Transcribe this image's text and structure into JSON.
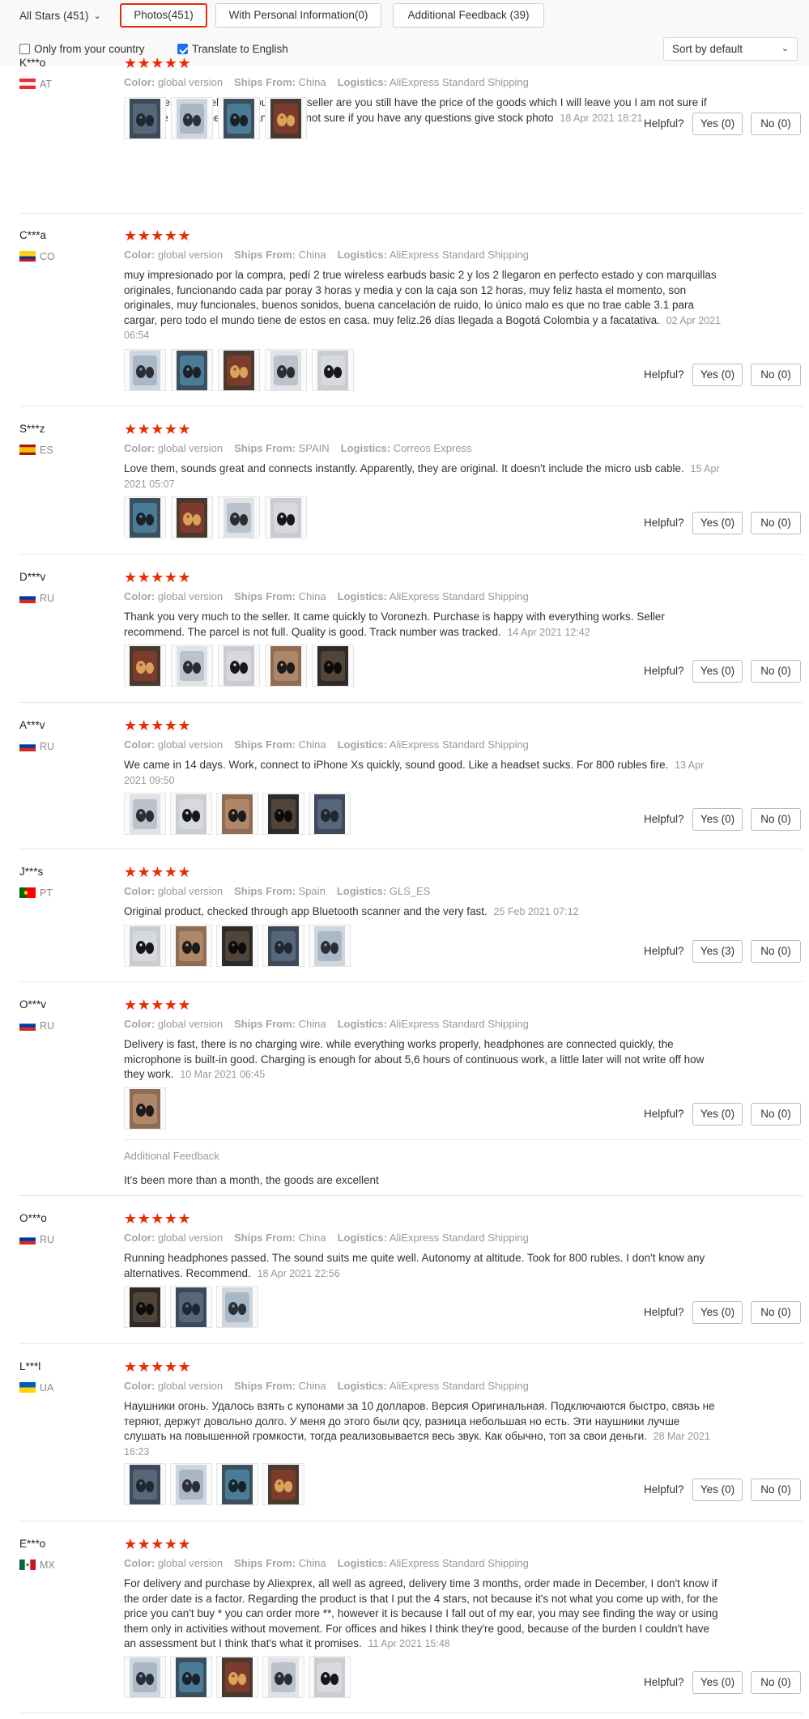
{
  "filters": {
    "all_stars": "All Stars (451)",
    "tabs": [
      {
        "label": "Photos(451)",
        "active": true
      },
      {
        "label": "With Personal Information(0)",
        "active": false
      },
      {
        "label": "Additional Feedback (39)",
        "active": false
      }
    ],
    "only_country": {
      "label": "Only from your country",
      "checked": false
    },
    "translate": {
      "label": "Translate to English",
      "checked": true
    },
    "sort": {
      "selected": "Sort by default"
    }
  },
  "labels": {
    "color": "Color:",
    "ships_from": "Ships From:",
    "logistics": "Logistics:",
    "helpful": "Helpful?",
    "additional_feedback": "Additional Feedback",
    "stars": "★★★★★"
  },
  "colors": {
    "accent": "#e62e04",
    "stars": "#e62e04",
    "meta_text": "#999999"
  },
  "reviews": [
    {
      "user": "K***o",
      "country": "AT",
      "flag": "flag-austria",
      "color": "global version",
      "ships_from": "China",
      "logistics": "AliExpress Standard Shipping",
      "text": "best seller great seller and buyer and seller are you still have the price of the goods which I will leave you I am not sure if you have any further assistance I am not sure if you have any questions give stock photo",
      "date": "18 Apr 2021 18:21",
      "photos": [
        "photo-phone-box",
        "photo-earbuds-blue",
        "photo-phone-screen",
        "photo-product-pack"
      ],
      "yes": "Yes (0)",
      "no": "No (0)"
    },
    {
      "user": "C***a",
      "country": "CO",
      "flag": "flag-colombia",
      "color": "global version",
      "ships_from": "China",
      "logistics": "AliExpress Standard Shipping",
      "text": "muy impresionado por la compra, pedí 2 true wireless earbuds basic 2 y los 2 llegaron en perfecto estado y con marquillas originales, funcionando cada par poray 3 horas y media y con la caja son 12 horas, muy feliz hasta el momento, son originales, muy funcionales, buenos sonidos, buena cancelación de ruido, lo único malo es que no trae cable 3.1 para cargar, pero todo el mundo tiene de estos en casa. muy feliz.26 días llegada a Bogotá Colombia y a facatativa.",
      "date": "02 Apr 2021 06:54",
      "photos": [
        "photo-box-front",
        "photo-earbuds-box",
        "photo-box-side",
        "photo-hand-earbuds",
        "photo-earbuds-case"
      ],
      "yes": "Yes (0)",
      "no": "No (0)"
    },
    {
      "user": "S***z",
      "country": "ES",
      "flag": "flag-spain",
      "color": "global version",
      "ships_from": "SPAIN",
      "logistics": "Correos Express",
      "text": "Love them, sounds great and connects instantly. Apparently, they are original. It doesn't include the micro usb cable.",
      "date": "15 Apr 2021 05:07",
      "photos": [
        "photo-earbud-hand",
        "photo-earbud-hand-2",
        "photo-earbud-hand-3",
        "photo-earbud-hand-4"
      ],
      "yes": "Yes (0)",
      "no": "No (0)"
    },
    {
      "user": "D***v",
      "country": "RU",
      "flag": "flag-russia",
      "color": "global version",
      "ships_from": "China",
      "logistics": "AliExpress Standard Shipping",
      "text": "Thank you very much to the seller. It came quickly to Voronezh. Purchase is happy with everything works. Seller recommend. The parcel is not full. Quality is good. Track number was tracked.",
      "date": "14 Apr 2021 12:42",
      "photos": [
        "photo-earbuds-table",
        "photo-box-blue",
        "photo-earbuds-open",
        "photo-earbuds-pair",
        "photo-case-closed"
      ],
      "yes": "Yes (0)",
      "no": "No (0)"
    },
    {
      "user": "A***v",
      "country": "RU",
      "flag": "flag-russia",
      "color": "global version",
      "ships_from": "China",
      "logistics": "AliExpress Standard Shipping",
      "text": "We came in 14 days. Work, connect to iPhone Xs quickly, sound good. Like a headset sucks. For 800 rubles fire.",
      "date": "13 Apr 2021 09:50",
      "photos": [
        "photo-earbud-palm",
        "photo-earbud-palm-2",
        "photo-case-open",
        "photo-case-dark",
        "photo-earbud-fingers"
      ],
      "yes": "Yes (0)",
      "no": "No (0)"
    },
    {
      "user": "J***s",
      "country": "PT",
      "flag": "flag-portugal",
      "color": "global version",
      "ships_from": "Spain",
      "logistics": "GLS_ES",
      "text": "Original product, checked through app Bluetooth scanner and the very fast.",
      "date": "25 Feb 2021 07:12",
      "photos": [
        "photo-box-white",
        "photo-box-white-2",
        "photo-phone-app",
        "photo-box-earbuds",
        "photo-box-hand"
      ],
      "yes": "Yes (3)",
      "no": "No (0)"
    },
    {
      "user": "O***v",
      "country": "RU",
      "flag": "flag-russia",
      "color": "global version",
      "ships_from": "China",
      "logistics": "AliExpress Standard Shipping",
      "text": "Delivery is fast, there is no charging wire. while everything works properly, headphones are connected quickly, the microphone is built-in good. Charging is enough for about 5,6 hours of continuous work, a little later will not write off how they work.",
      "date": "10 Mar 2021 06:45",
      "photos": [
        "photo-earbuds-desk"
      ],
      "yes": "Yes (0)",
      "no": "No (0)",
      "additional": "It's been more than a month, the goods are excellent"
    },
    {
      "user": "O***o",
      "country": "RU",
      "flag": "flag-russia",
      "color": "global version",
      "ships_from": "China",
      "logistics": "AliExpress Standard Shipping",
      "text": "Running headphones passed. The sound suits me quite well. Autonomy at altitude. Took for 800 rubles. I don't know any alternatives. Recommend.",
      "date": "18 Apr 2021 22:56",
      "photos": [
        "photo-earbuds-wood",
        "photo-earbuds-wood-2",
        "photo-earbuds-wood-3"
      ],
      "yes": "Yes (0)",
      "no": "No (0)"
    },
    {
      "user": "L***l",
      "country": "UA",
      "flag": "flag-ukraine",
      "color": "global version",
      "ships_from": "China",
      "logistics": "AliExpress Standard Shipping",
      "text": "Наушники огонь. Удалось взять с купонами за 10 долларов. Версия Оригинальная. Подключаются быстро, связь не теряют, держут довольно долго. У меня до этого были qcy, разница небольшая но есть. Эти наушники лучше слушать на повышенной громкости, тогда реализовывается весь звук. Как обычно, топ за свои деньги.",
      "date": "28 Mar 2021 16:23",
      "photos": [
        "photo-earbud-grey",
        "photo-earbud-grey-2",
        "photo-earbud-grey-3",
        "photo-earbud-grey-4"
      ],
      "yes": "Yes (0)",
      "no": "No (0)"
    },
    {
      "user": "E***o",
      "country": "MX",
      "flag": "flag-mexico",
      "color": "global version",
      "ships_from": "China",
      "logistics": "AliExpress Standard Shipping",
      "text": "For delivery and purchase by Aliexprex, all well as agreed, delivery time 3 months, order made in December, I don't know if the order date is a factor. Regarding the product is that I put the 4 stars, not because it's not what you come up with, for the price you can't buy * you can order more **, however it is because I fall out of my ear, you may see finding the way or using them only in activities without movement. For offices and hikes I think they're good, because of the burden I couldn't have an assessment but I think that's what it promises.",
      "date": "11 Apr 2021 15:48",
      "photos": [
        "photo-box-gold",
        "photo-earbud-dark",
        "photo-case-wood",
        "photo-earbud-black",
        "photo-earbuds-night"
      ],
      "yes": "Yes (0)",
      "no": "No (0)"
    }
  ]
}
